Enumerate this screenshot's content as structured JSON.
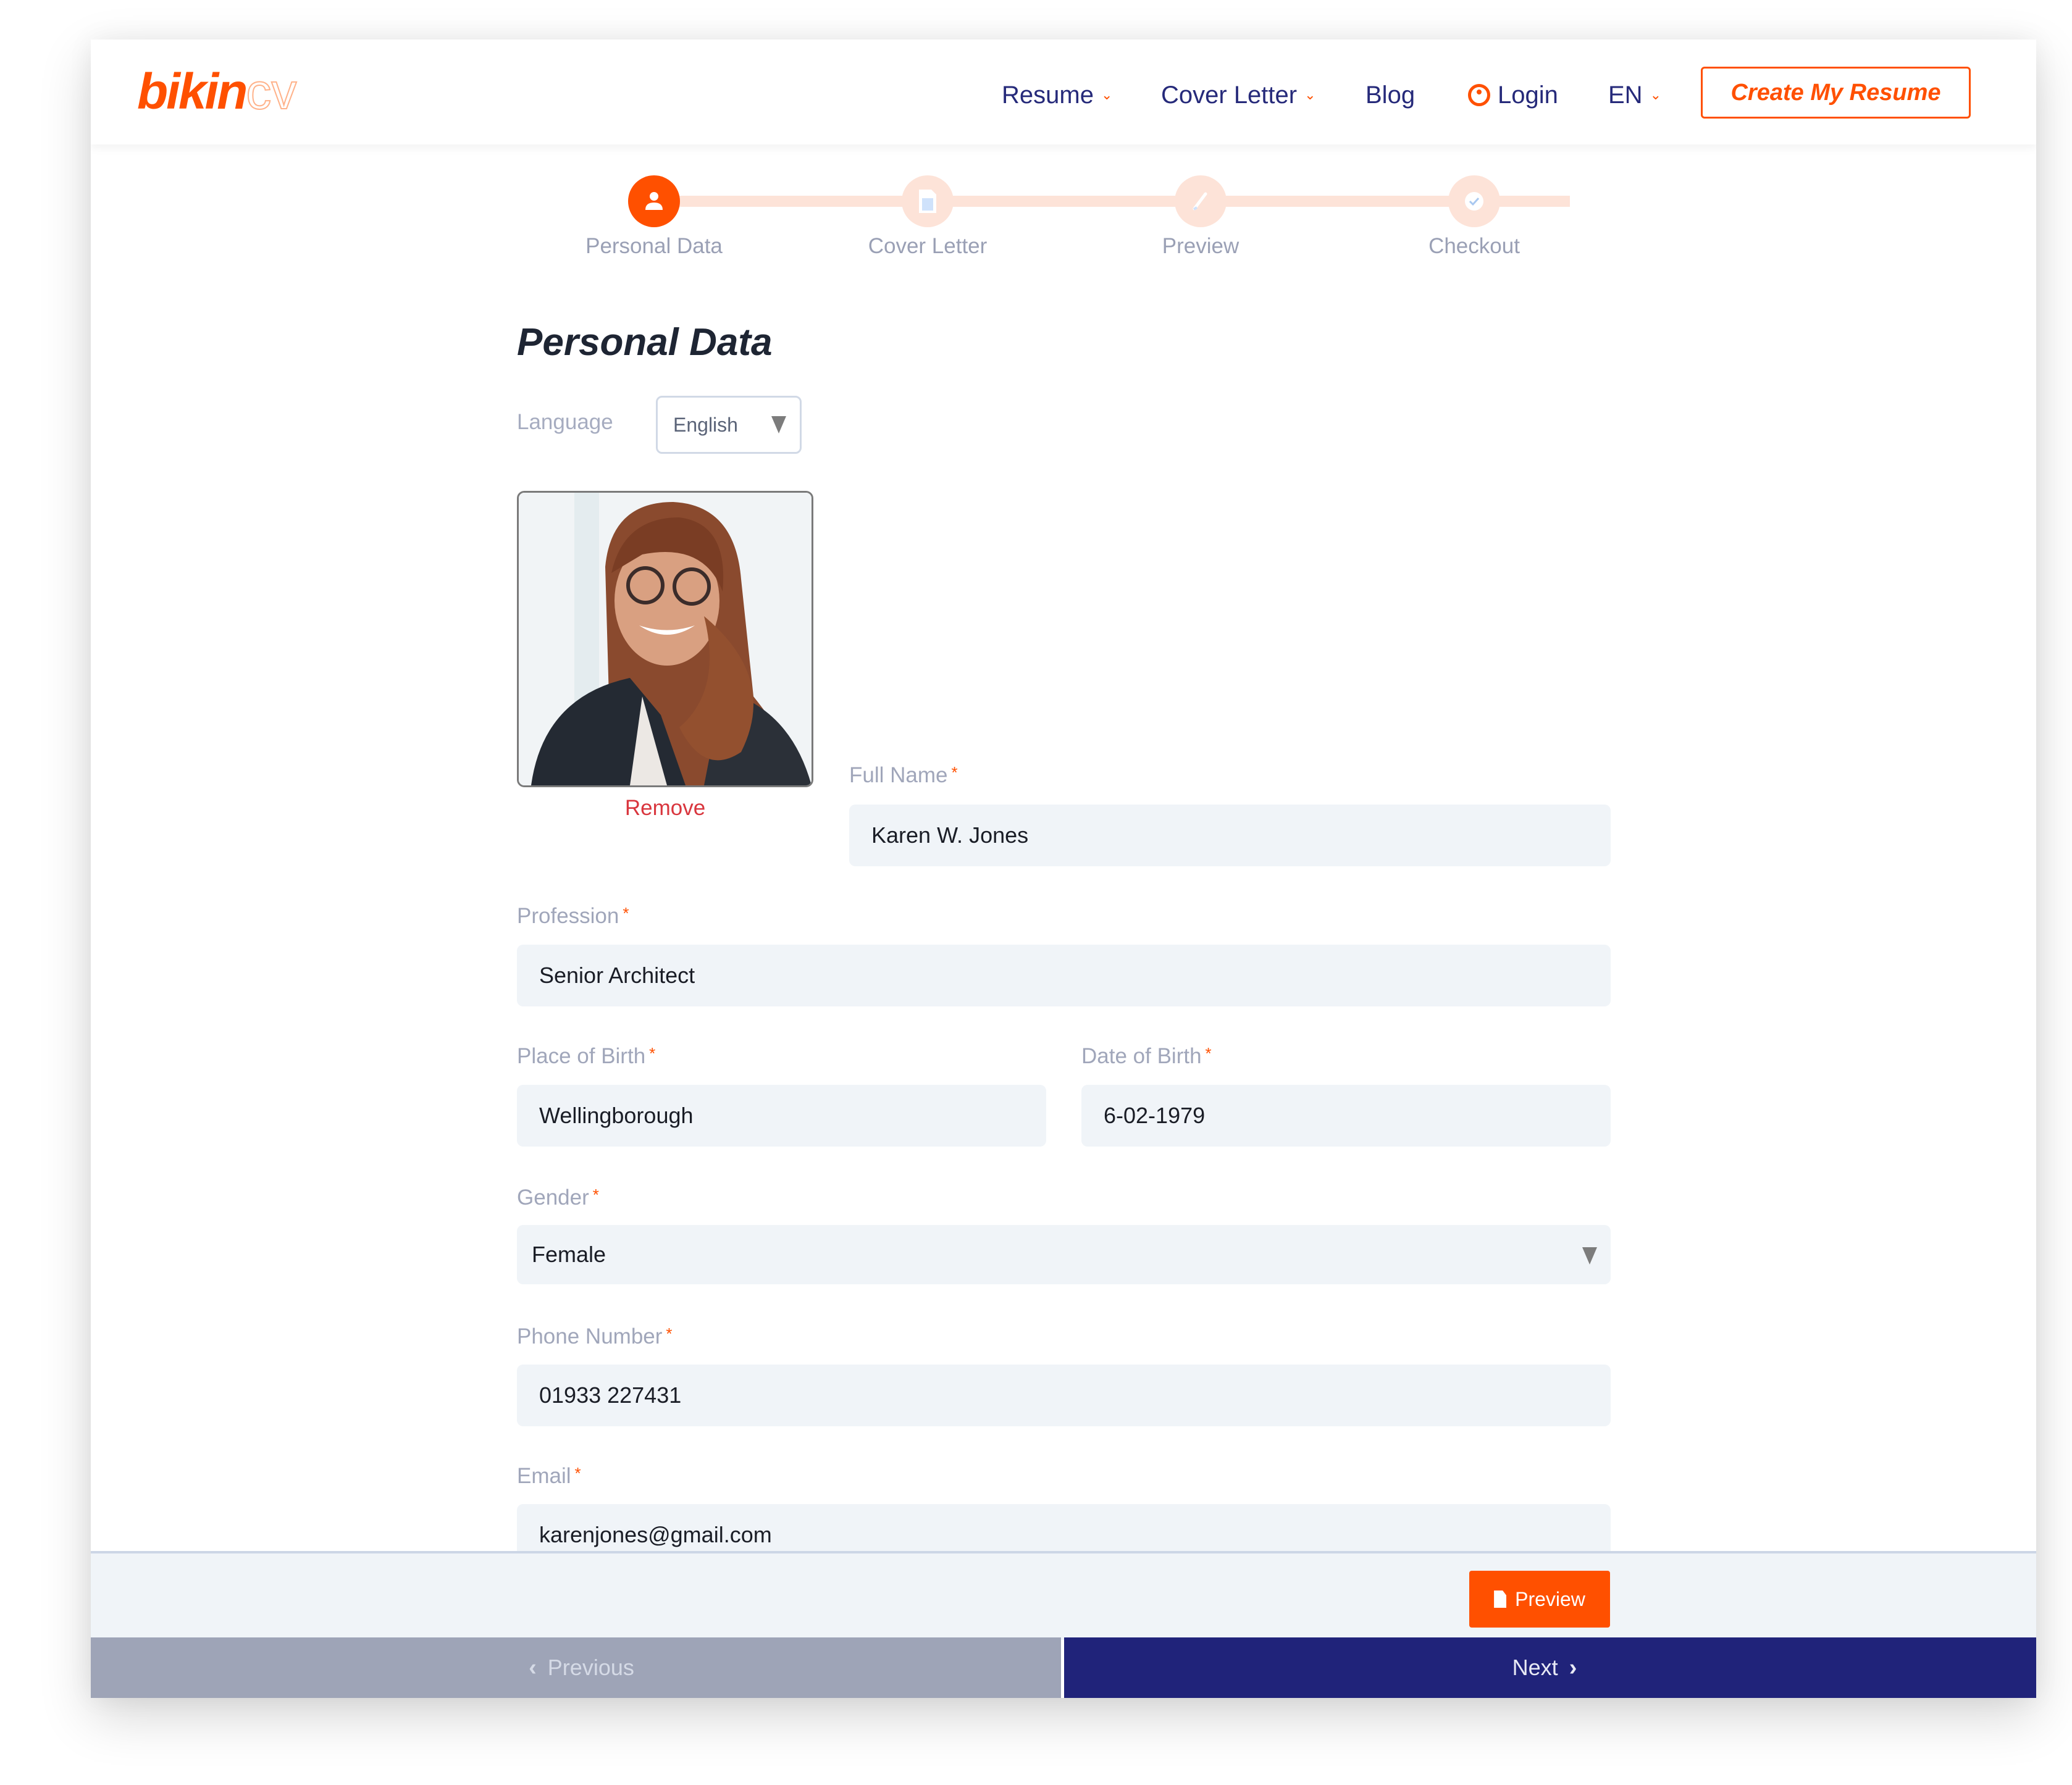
{
  "brand": {
    "logo_primary": "bikin",
    "logo_secondary": "cv",
    "accent": "#ff5000",
    "navy": "#20237a"
  },
  "nav": {
    "items": [
      {
        "label": "Resume",
        "has_dropdown": true
      },
      {
        "label": "Cover Letter",
        "has_dropdown": true
      },
      {
        "label": "Blog",
        "has_dropdown": false
      },
      {
        "label": "Login",
        "icon": "user-circle-icon"
      },
      {
        "label": "EN",
        "has_dropdown": true
      }
    ],
    "cta_label": "Create My Resume"
  },
  "stepper": {
    "current": 1,
    "steps": [
      {
        "label": "Personal Data",
        "icon": "user-icon"
      },
      {
        "label": "Cover Letter",
        "icon": "document-icon"
      },
      {
        "label": "Preview",
        "icon": "pencil-icon"
      },
      {
        "label": "Checkout",
        "icon": "check-icon"
      }
    ]
  },
  "form": {
    "title": "Personal Data",
    "language": {
      "label": "Language",
      "value": "English"
    },
    "photo": {
      "remove_label": "Remove"
    },
    "full_name": {
      "label": "Full Name",
      "required": "*",
      "value": "Karen W. Jones"
    },
    "profession": {
      "label": "Profession",
      "required": "*",
      "value": "Senior Architect"
    },
    "place_of_birth": {
      "label": "Place of Birth",
      "required": "*",
      "value": "Wellingborough"
    },
    "date_of_birth": {
      "label": "Date of Birth",
      "required": "*",
      "value": "6-02-1979"
    },
    "gender": {
      "label": "Gender",
      "required": "*",
      "value": "Female"
    },
    "phone": {
      "label": "Phone Number",
      "required": "*",
      "value": "01933 227431"
    },
    "email": {
      "label": "Email",
      "required": "*",
      "value": "karenjones@gmail.com"
    }
  },
  "footer": {
    "preview_label": "Preview",
    "previous_label": "Previous",
    "next_label": "Next"
  }
}
